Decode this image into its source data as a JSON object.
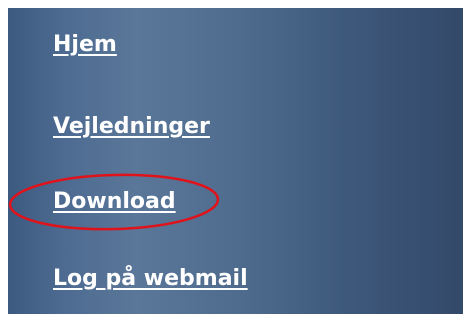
{
  "nav": {
    "items": [
      {
        "label": "Hjem"
      },
      {
        "label": "Vejledninger"
      },
      {
        "label": "Download"
      },
      {
        "label": "Log på webmail"
      }
    ]
  },
  "annotation": {
    "highlighted_item": "Download",
    "color": "#e0121a"
  },
  "colors": {
    "panel_background": "#4d6b91",
    "link_text": "#ffffff"
  }
}
